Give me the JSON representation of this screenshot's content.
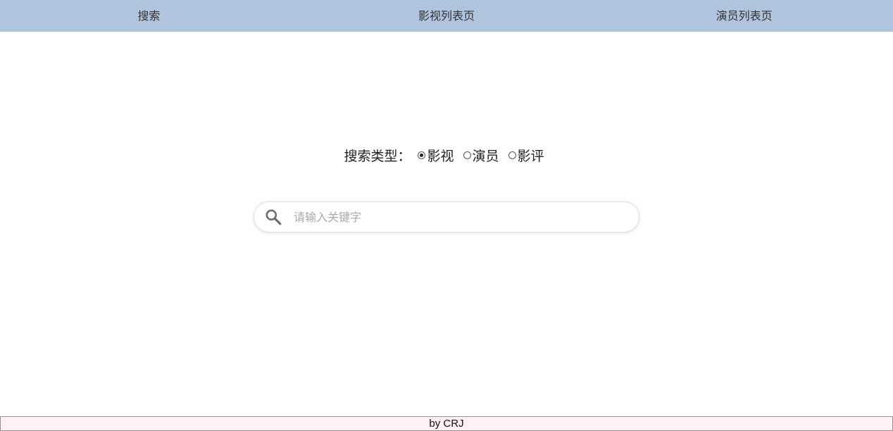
{
  "nav": {
    "items": [
      {
        "label": "搜索"
      },
      {
        "label": "影视列表页"
      },
      {
        "label": "演员列表页"
      }
    ],
    "background": "#b0c4de"
  },
  "search_type": {
    "label": "搜索类型：",
    "options": [
      {
        "label": "影视",
        "checked": true
      },
      {
        "label": "演员",
        "checked": false
      },
      {
        "label": "影评",
        "checked": false
      }
    ]
  },
  "search": {
    "placeholder": "请输入关键字",
    "value": "",
    "icon": "search-icon"
  },
  "footer": {
    "text": "by CRJ",
    "background": "#fff0f5"
  }
}
